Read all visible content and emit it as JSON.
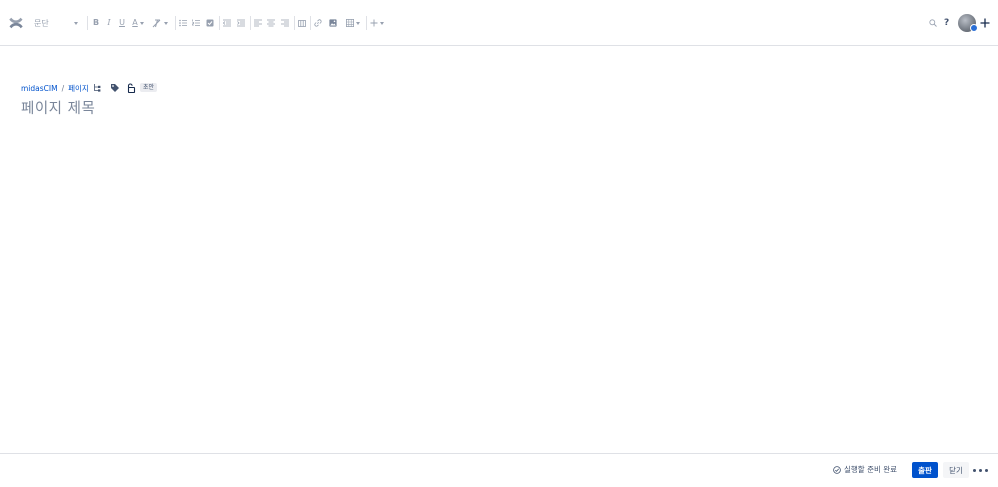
{
  "toolbar": {
    "paragraph_select": {
      "value": "문단"
    },
    "icons": [
      "confluence-logo",
      "bold-icon",
      "italic-icon",
      "underline-icon",
      "text-color-icon",
      "clear-format-icon",
      "bullet-list-icon",
      "numbered-list-icon",
      "task-list-icon",
      "outdent-icon",
      "indent-icon",
      "align-left-icon",
      "align-center-icon",
      "align-right-icon",
      "layout-icon",
      "link-icon",
      "image-icon",
      "table-icon",
      "insert-plus-icon",
      "search-icon",
      "help-icon",
      "avatar",
      "create-plus-icon"
    ],
    "bold_glyph": "B",
    "italic_glyph": "I",
    "underline_glyph": "U",
    "text_color_glyph": "A",
    "help_glyph": "?"
  },
  "breadcrumb": {
    "space": "midasCIM",
    "separator": "/",
    "page": "페이지"
  },
  "status_badge": "초안",
  "title": {
    "placeholder": "페이지 제목"
  },
  "footer": {
    "ready_text": "실행할 준비 완료",
    "publish_label": "출판",
    "close_label": "닫기"
  },
  "colors": {
    "primary": "#0052cc",
    "icon": "#97a0af",
    "border": "#dfe1e6"
  }
}
